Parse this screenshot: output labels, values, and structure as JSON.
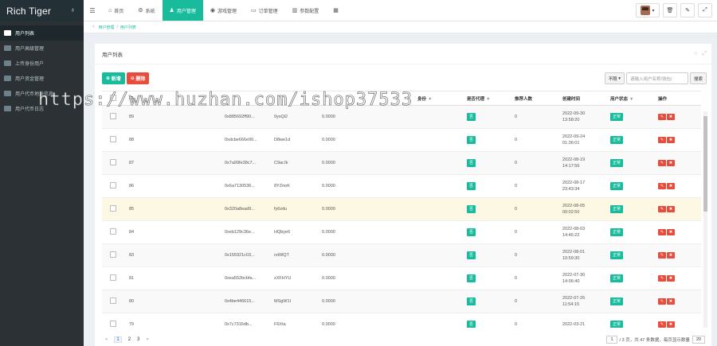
{
  "brand": {
    "title": "Rich Tiger",
    "toggle_icon": "bell-icon"
  },
  "sidebar": {
    "items": [
      {
        "label": "用户列表",
        "active": true
      },
      {
        "label": "用户高级管理",
        "active": false
      },
      {
        "label": "上传身份用户",
        "active": false
      },
      {
        "label": "用户资金管理",
        "active": false
      },
      {
        "label": "用户代币地址信息",
        "active": false
      },
      {
        "label": "用户代币日志",
        "active": false
      }
    ]
  },
  "topnav": {
    "tabs": [
      {
        "icon": "⌂",
        "label": "首页",
        "active": false
      },
      {
        "icon": "⚙",
        "label": "系统",
        "active": false
      },
      {
        "icon": "♟",
        "label": "用户管理",
        "active": true
      },
      {
        "icon": "◉",
        "label": "游戏管理",
        "active": false
      },
      {
        "icon": "▭",
        "label": "订单管理",
        "active": false
      },
      {
        "icon": "▥",
        "label": "参数配置",
        "active": false
      },
      {
        "icon": "▦",
        "label": "",
        "active": false
      }
    ]
  },
  "breadcrumb": {
    "home": "♀",
    "items": [
      "用户管理",
      "用户列表"
    ]
  },
  "panel": {
    "title": "用户列表"
  },
  "toolbar": {
    "add_label": "新增",
    "delete_label": "删除",
    "filter_select": "不限",
    "search_placeholder": "请输入用户名称/钱包/",
    "search_button": "搜索"
  },
  "table": {
    "columns": [
      "",
      "ID",
      "",
      "",
      "",
      "",
      "身份",
      "是否代理",
      "推荐人数",
      "创建时间",
      "用户状态",
      "操作"
    ],
    "rows": [
      {
        "id": "89",
        "wallet": "0x885692ff90...",
        "code": "0ysQi2",
        "balance": "0.0000",
        "agent": "否",
        "refs": "0",
        "date": "2022-09-30",
        "time": "13:58:20",
        "status": "正常"
      },
      {
        "id": "88",
        "wallet": "0xdcbe666e99...",
        "code": "D8we1d",
        "balance": "0.0000",
        "agent": "否",
        "refs": "0",
        "date": "2022-09-24",
        "time": "01:36:01",
        "status": "正常"
      },
      {
        "id": "87",
        "wallet": "0x7a99fe38c7...",
        "code": "C9arJk",
        "balance": "0.0000",
        "agent": "否",
        "refs": "0",
        "date": "2022-08-19",
        "time": "14:17:56",
        "status": "正常"
      },
      {
        "id": "86",
        "wallet": "0x6a7130536...",
        "code": "8YZnoK",
        "balance": "0.0000",
        "agent": "否",
        "refs": "0",
        "date": "2022-08-17",
        "time": "23:43:34",
        "status": "正常"
      },
      {
        "id": "85",
        "wallet": "0x320a8ead9...",
        "code": "fy6zdu",
        "balance": "0.0000",
        "agent": "否",
        "refs": "0",
        "date": "2022-08-05",
        "time": "00:02:50",
        "status": "正常"
      },
      {
        "id": "84",
        "wallet": "0xeb129c36e...",
        "code": "HQbye6",
        "balance": "0.0000",
        "agent": "否",
        "refs": "0",
        "date": "2022-08-03",
        "time": "14:46:22",
        "status": "正常"
      },
      {
        "id": "83",
        "wallet": "0x155921c03...",
        "code": "rxtWQT",
        "balance": "0.0000",
        "agent": "否",
        "refs": "0",
        "date": "2022-08-01",
        "time": "10:59:30",
        "status": "正常"
      },
      {
        "id": "81",
        "wallet": "0xea552bcbfa...",
        "code": "zXFHYU",
        "balance": "0.0000",
        "agent": "否",
        "refs": "0",
        "date": "2022-07-30",
        "time": "14:06:40",
        "status": "正常"
      },
      {
        "id": "80",
        "wallet": "0x4be446615...",
        "code": "MSgW1I",
        "balance": "0.0000",
        "agent": "否",
        "refs": "0",
        "date": "2022-07-26",
        "time": "11:54:15",
        "status": "正常"
      },
      {
        "id": "79",
        "wallet": "0x7c7316db...",
        "code": "F6Xta",
        "balance": "0.0000",
        "agent": "否",
        "refs": "0",
        "date": "2022-03-21",
        "time": "",
        "status": "正常"
      }
    ]
  },
  "pagination": {
    "prev": "«",
    "pages": [
      "1",
      "2",
      "3"
    ],
    "next": "»",
    "current_input": "1",
    "summary": "/ 3 页，共 47 条数据，每页显示数量",
    "per_page": "20"
  },
  "watermark": "https://www.huzhan.com/ishop37533"
}
